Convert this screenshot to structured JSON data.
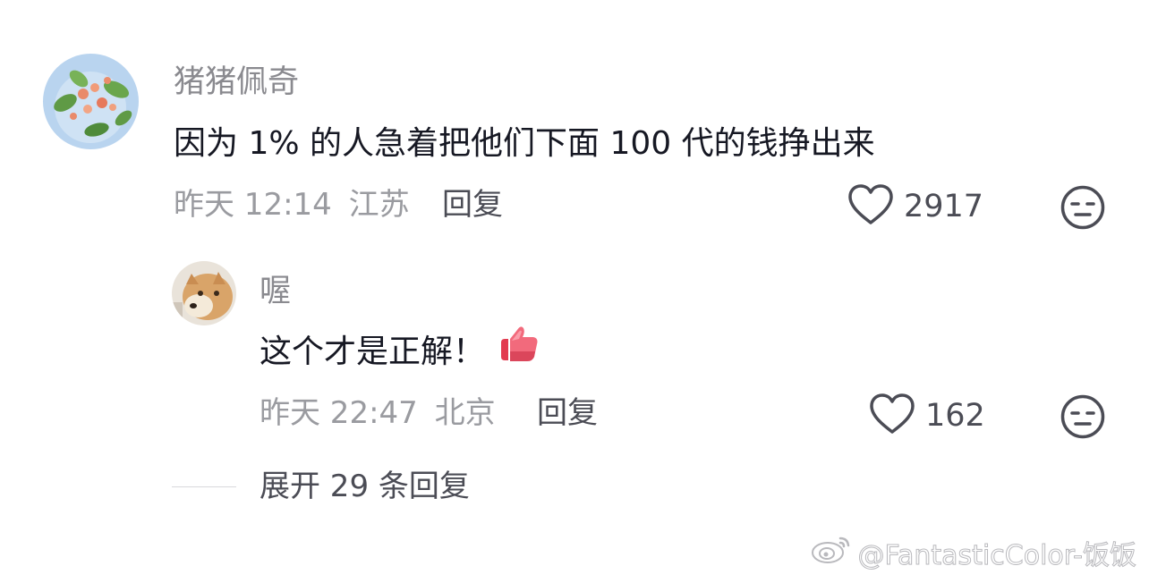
{
  "comment": {
    "username": "猪猪佩奇",
    "text": "因为 1% 的人急着把他们下面 100 代的钱挣出来",
    "time": "昨天 12:14",
    "location": "江苏",
    "reply_label": "回复",
    "like_count": "2917"
  },
  "reply": {
    "username": "喔",
    "text": "这个才是正解！",
    "emoji": "thumbs-up-emoji",
    "time": "昨天 22:47",
    "location": "北京",
    "reply_label": "回复",
    "like_count": "162"
  },
  "expand": {
    "label": "展开 29 条回复"
  },
  "watermark": {
    "text": "@FantasticColor-饭饭"
  },
  "icons": {
    "like": "heart-outline-icon",
    "face": "neutral-face-icon",
    "watermark_logo": "weibo-logo-icon"
  },
  "colors": {
    "text_primary": "#161823",
    "text_secondary": "#9a9ba0",
    "emoji_red": "#e8455a"
  }
}
